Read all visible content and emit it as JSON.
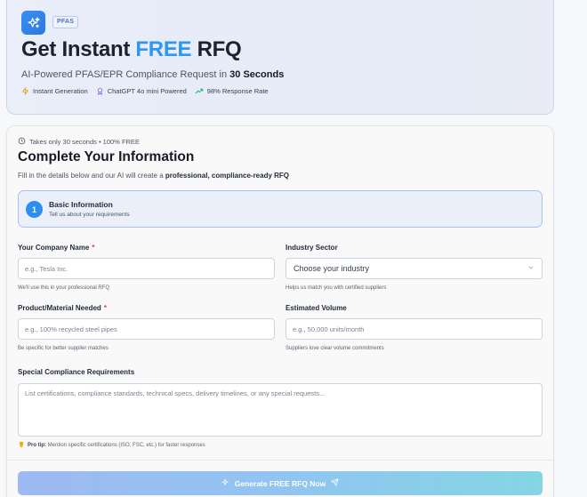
{
  "hero": {
    "badge": "PFAS",
    "title_prefix": "Get Instant ",
    "title_accent": "FREE",
    "title_suffix": " RFQ",
    "subtitle_prefix": "AI-Powered PFAS/EPR Compliance Request in ",
    "subtitle_bold": "30 Seconds",
    "features": [
      {
        "icon": "lightning-icon",
        "label": "Instant Generation"
      },
      {
        "icon": "award-icon",
        "label": "ChatGPT 4o mini Powered"
      },
      {
        "icon": "trending-up-icon",
        "label": "98% Response Rate"
      }
    ]
  },
  "form": {
    "takes_text": "Takes only 30 seconds • 100% FREE",
    "title": "Complete Your Information",
    "desc_prefix": "Fill in the details below and our AI will create a ",
    "desc_bold": "professional, compliance-ready RFQ",
    "step": {
      "number": "1",
      "title": "Basic Information",
      "subtitle": "Tell us about your requirements"
    },
    "company": {
      "label": "Your Company Name",
      "required": "*",
      "placeholder": "e.g., Tesla Inc.",
      "hint": "We'll use this in your professional RFQ"
    },
    "industry": {
      "label": "Industry Sector",
      "selected": "Choose your industry",
      "hint": "Helps us match you with certified suppliers"
    },
    "product": {
      "label": "Product/Material Needed",
      "required": "*",
      "placeholder": "e.g., 100% recycled steel pipes",
      "hint": "Be specific for better supplier matches"
    },
    "volume": {
      "label": "Estimated Volume",
      "placeholder": "e.g., 50,000 units/month",
      "hint": "Suppliers love clear volume commitments"
    },
    "special": {
      "label": "Special Compliance Requirements",
      "placeholder": "List certifications, compliance standards, technical specs, delivery timelines, or any special requests..."
    },
    "protip_bold": "Pro tip:",
    "protip_text": " Mention specific certifications (ISO, FSC, etc.) for faster responses",
    "submit_label": "Generate FREE RFQ Now"
  },
  "colors": {
    "accent": "#2e97ef",
    "required": "#e0413a"
  }
}
